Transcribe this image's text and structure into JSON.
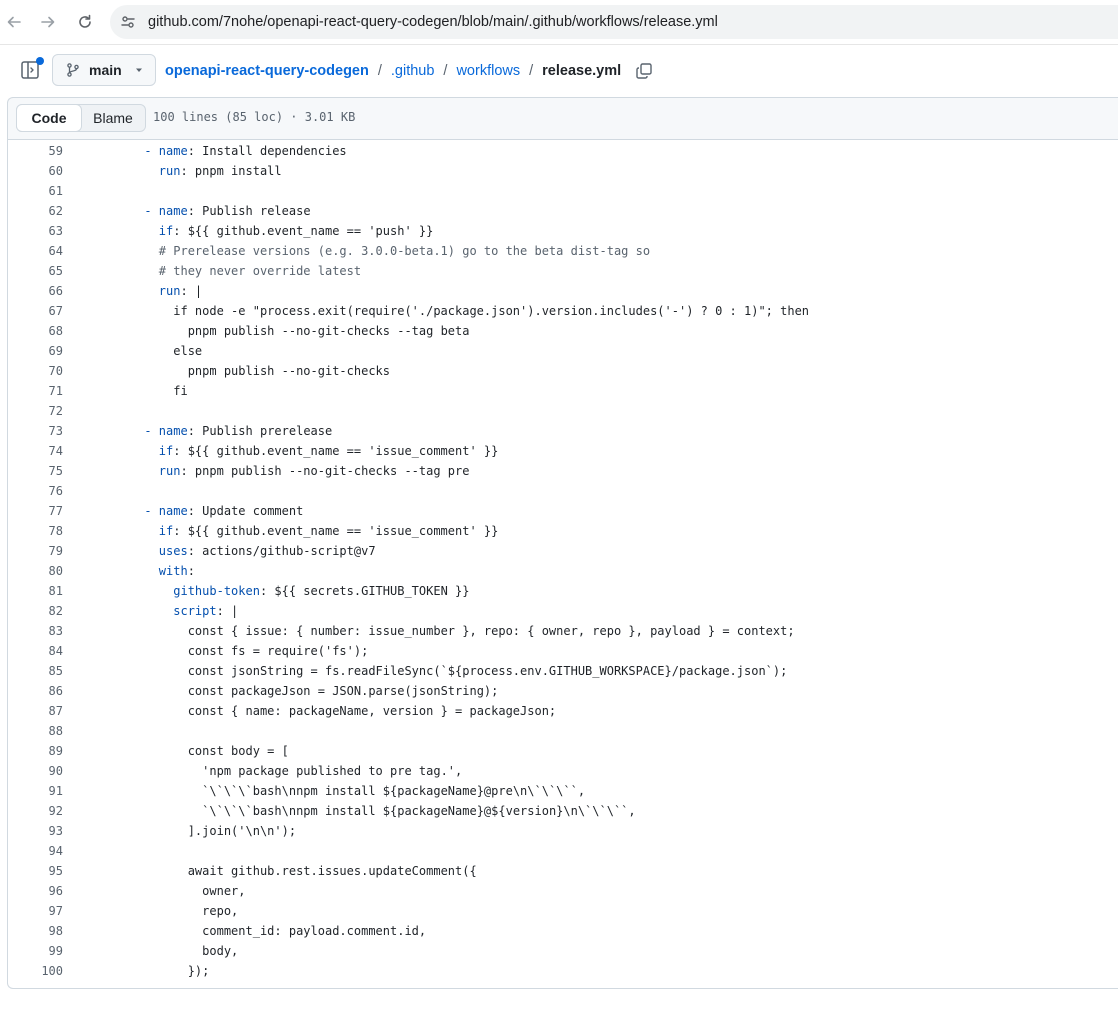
{
  "browser": {
    "url": "github.com/7nohe/openapi-react-query-codegen/blob/main/.github/workflows/release.yml"
  },
  "file_nav": {
    "branch": "main",
    "breadcrumb": {
      "repo": "openapi-react-query-codegen",
      "dir1": ".github",
      "dir2": "workflows",
      "file": "release.yml",
      "separator": "/"
    }
  },
  "toolbar": {
    "code_tab": "Code",
    "blame_tab": "Blame",
    "meta": "100 lines (85 loc) · 3.01 KB"
  },
  "code": [
    {
      "n": "59",
      "i": "      ",
      "s": [
        {
          "k": "- name"
        },
        {
          "t": ": Install dependencies"
        }
      ]
    },
    {
      "n": "60",
      "i": "        ",
      "s": [
        {
          "k": "run"
        },
        {
          "t": ": pnpm install"
        }
      ]
    },
    {
      "n": "61",
      "i": "",
      "s": []
    },
    {
      "n": "62",
      "i": "      ",
      "s": [
        {
          "k": "- name"
        },
        {
          "t": ": Publish release"
        }
      ]
    },
    {
      "n": "63",
      "i": "        ",
      "s": [
        {
          "k": "if"
        },
        {
          "t": ": ${{ github.event_name == 'push' }}"
        }
      ]
    },
    {
      "n": "64",
      "i": "        ",
      "s": [
        {
          "c": "# Prerelease versions (e.g. 3.0.0-beta.1) go to the beta dist-tag so"
        }
      ]
    },
    {
      "n": "65",
      "i": "        ",
      "s": [
        {
          "c": "# they never override latest"
        }
      ]
    },
    {
      "n": "66",
      "i": "        ",
      "s": [
        {
          "k": "run"
        },
        {
          "t": ": |"
        }
      ]
    },
    {
      "n": "67",
      "i": "          ",
      "s": [
        {
          "t": "if node -e \"process.exit(require('./package.json').version.includes('-') ? 0 : 1)\"; then"
        }
      ]
    },
    {
      "n": "68",
      "i": "            ",
      "s": [
        {
          "t": "pnpm publish --no-git-checks --tag beta"
        }
      ]
    },
    {
      "n": "69",
      "i": "          ",
      "s": [
        {
          "t": "else"
        }
      ]
    },
    {
      "n": "70",
      "i": "            ",
      "s": [
        {
          "t": "pnpm publish --no-git-checks"
        }
      ]
    },
    {
      "n": "71",
      "i": "          ",
      "s": [
        {
          "t": "fi"
        }
      ]
    },
    {
      "n": "72",
      "i": "",
      "s": []
    },
    {
      "n": "73",
      "i": "      ",
      "s": [
        {
          "k": "- name"
        },
        {
          "t": ": Publish prerelease"
        }
      ]
    },
    {
      "n": "74",
      "i": "        ",
      "s": [
        {
          "k": "if"
        },
        {
          "t": ": ${{ github.event_name == 'issue_comment' }}"
        }
      ]
    },
    {
      "n": "75",
      "i": "        ",
      "s": [
        {
          "k": "run"
        },
        {
          "t": ": pnpm publish --no-git-checks --tag pre"
        }
      ]
    },
    {
      "n": "76",
      "i": "",
      "s": []
    },
    {
      "n": "77",
      "i": "      ",
      "s": [
        {
          "k": "- name"
        },
        {
          "t": ": Update comment"
        }
      ]
    },
    {
      "n": "78",
      "i": "        ",
      "s": [
        {
          "k": "if"
        },
        {
          "t": ": ${{ github.event_name == 'issue_comment' }}"
        }
      ]
    },
    {
      "n": "79",
      "i": "        ",
      "s": [
        {
          "k": "uses"
        },
        {
          "t": ": actions/github-script@v7"
        }
      ]
    },
    {
      "n": "80",
      "i": "        ",
      "s": [
        {
          "k": "with"
        },
        {
          "t": ":"
        }
      ]
    },
    {
      "n": "81",
      "i": "          ",
      "s": [
        {
          "k": "github-token"
        },
        {
          "t": ": ${{ secrets.GITHUB_TOKEN }}"
        }
      ]
    },
    {
      "n": "82",
      "i": "          ",
      "s": [
        {
          "k": "script"
        },
        {
          "t": ": |"
        }
      ]
    },
    {
      "n": "83",
      "i": "            ",
      "s": [
        {
          "t": "const { issue: { number: issue_number }, repo: { owner, repo }, payload } = context;"
        }
      ]
    },
    {
      "n": "84",
      "i": "            ",
      "s": [
        {
          "t": "const fs = require('fs');"
        }
      ]
    },
    {
      "n": "85",
      "i": "            ",
      "s": [
        {
          "t": "const jsonString = fs.readFileSync(`${process.env.GITHUB_WORKSPACE}/package.json`);"
        }
      ]
    },
    {
      "n": "86",
      "i": "            ",
      "s": [
        {
          "t": "const packageJson = JSON.parse(jsonString);"
        }
      ]
    },
    {
      "n": "87",
      "i": "            ",
      "s": [
        {
          "t": "const { name: packageName, version } = packageJson;"
        }
      ]
    },
    {
      "n": "88",
      "i": "",
      "s": []
    },
    {
      "n": "89",
      "i": "            ",
      "s": [
        {
          "t": "const body = ["
        }
      ]
    },
    {
      "n": "90",
      "i": "              ",
      "s": [
        {
          "t": "'npm package published to pre tag.',"
        }
      ]
    },
    {
      "n": "91",
      "i": "              ",
      "s": [
        {
          "t": "`\\`\\`\\`bash\\nnpm install ${packageName}@pre\\n\\`\\`\\``,"
        }
      ]
    },
    {
      "n": "92",
      "i": "              ",
      "s": [
        {
          "t": "`\\`\\`\\`bash\\nnpm install ${packageName}@${version}\\n\\`\\`\\``,"
        }
      ]
    },
    {
      "n": "93",
      "i": "            ",
      "s": [
        {
          "t": "].join('\\n\\n');"
        }
      ]
    },
    {
      "n": "94",
      "i": "",
      "s": []
    },
    {
      "n": "95",
      "i": "            ",
      "s": [
        {
          "t": "await github.rest.issues.updateComment({"
        }
      ]
    },
    {
      "n": "96",
      "i": "              ",
      "s": [
        {
          "t": "owner,"
        }
      ]
    },
    {
      "n": "97",
      "i": "              ",
      "s": [
        {
          "t": "repo,"
        }
      ]
    },
    {
      "n": "98",
      "i": "              ",
      "s": [
        {
          "t": "comment_id: payload.comment.id,"
        }
      ]
    },
    {
      "n": "99",
      "i": "              ",
      "s": [
        {
          "t": "body,"
        }
      ]
    },
    {
      "n": "100",
      "i": "            ",
      "s": [
        {
          "t": "});"
        }
      ]
    }
  ]
}
